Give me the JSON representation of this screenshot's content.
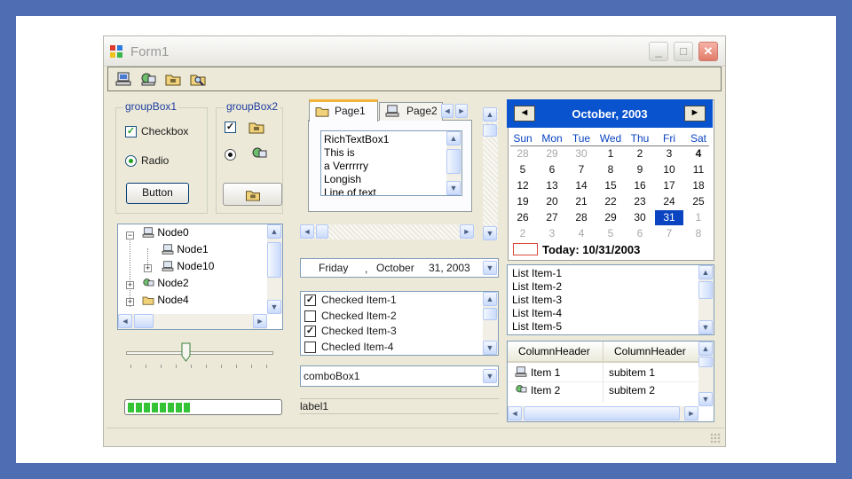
{
  "window": {
    "title": "Form1",
    "buttons": {
      "minimize": "_",
      "maximize": "□",
      "close": "✕"
    }
  },
  "toolbar": {
    "icons": [
      "computer-icon",
      "network-computer-icon",
      "folder-icon",
      "search-folder-icon"
    ]
  },
  "groupBox1": {
    "title": "groupBox1",
    "checkbox_label": "Checkbox",
    "checkbox_checked": true,
    "radio_label": "Radio",
    "radio_selected": true,
    "button_label": "Button"
  },
  "groupBox2": {
    "title": "groupBox2",
    "checkbox_checked": true,
    "radio_selected": true
  },
  "tabs": {
    "items": [
      "Page1",
      "Page2"
    ]
  },
  "richtext": {
    "lines": [
      "RichTextBox1",
      "This is",
      "a Verrrrry",
      "Longish",
      "Line of text"
    ]
  },
  "tree": {
    "nodes": [
      {
        "label": "Node0",
        "level": 0,
        "expander": "−"
      },
      {
        "label": "Node1",
        "level": 1,
        "expander": ""
      },
      {
        "label": "Node10",
        "level": 1,
        "expander": "+"
      },
      {
        "label": "Node2",
        "level": 0,
        "expander": "+"
      },
      {
        "label": "Node4",
        "level": 0,
        "expander": "+"
      }
    ]
  },
  "trackbar": {
    "value": 0.4
  },
  "progress": {
    "value": 0.45,
    "segments": 8
  },
  "datepicker": {
    "day": "Friday",
    "sep": ",",
    "month": "October",
    "date": "31, 2003"
  },
  "checkedlist": {
    "items": [
      {
        "label": "Checked Item-1",
        "checked": true
      },
      {
        "label": "Checked Item-2",
        "checked": false
      },
      {
        "label": "Checked Item-3",
        "checked": true
      },
      {
        "label": "Checled Item-4",
        "checked": false
      }
    ]
  },
  "combo": {
    "value": "comboBox1"
  },
  "label1": {
    "text": "label1"
  },
  "calendar": {
    "month_label": "October, 2003",
    "prev": "◄",
    "next": "►",
    "dow": [
      "Sun",
      "Mon",
      "Tue",
      "Wed",
      "Thu",
      "Fri",
      "Sat"
    ],
    "weeks": [
      [
        "28",
        "29",
        "30",
        "1",
        "2",
        "3",
        "4"
      ],
      [
        "5",
        "6",
        "7",
        "8",
        "9",
        "10",
        "11"
      ],
      [
        "12",
        "13",
        "14",
        "15",
        "16",
        "17",
        "18"
      ],
      [
        "19",
        "20",
        "21",
        "22",
        "23",
        "24",
        "25"
      ],
      [
        "26",
        "27",
        "28",
        "29",
        "30",
        "31",
        "1"
      ],
      [
        "2",
        "3",
        "4",
        "5",
        "6",
        "7",
        "8"
      ]
    ],
    "today_label": "Today: 10/31/2003",
    "selected": "31"
  },
  "listbox": {
    "items": [
      "List Item-1",
      "List Item-2",
      "List Item-3",
      "List Item-4",
      "List Item-5"
    ]
  },
  "listview": {
    "headers": [
      "ColumnHeader",
      "ColumnHeader"
    ],
    "rows": [
      {
        "col1": "Item 1",
        "col2": "subitem 1",
        "icon": "computer-icon"
      },
      {
        "col1": "Item 2",
        "col2": "subitem 2",
        "icon": "network-computer-icon"
      }
    ]
  },
  "colors": {
    "accent": "#0a53cf",
    "progress": "#34c237",
    "groupbox_title": "#1f3ea0"
  }
}
